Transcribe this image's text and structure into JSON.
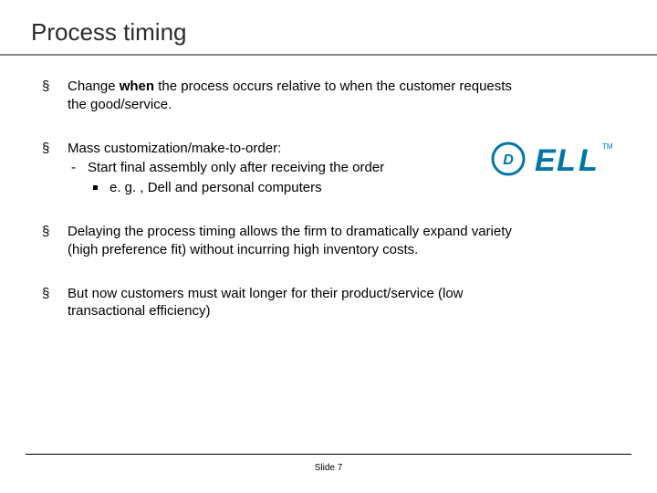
{
  "title": "Process timing",
  "bullets": {
    "b1_pre": "Change ",
    "b1_bold": "when",
    "b1_post": " the process occurs relative to when the customer requests the good/service.",
    "b2": "Mass customization/make-to-order:",
    "b2_s1": "Start final assembly only after receiving the order",
    "b2_s1_s1": "e. g. , Dell and personal computers",
    "b3": "Delaying the process timing allows the firm to dramatically expand variety (high preference fit) without incurring high inventory costs.",
    "b4": "But now customers must wait longer for their product/service (low transactional efficiency)"
  },
  "logo": {
    "name": "DELL",
    "tm": "TM"
  },
  "footer": "Slide 7"
}
